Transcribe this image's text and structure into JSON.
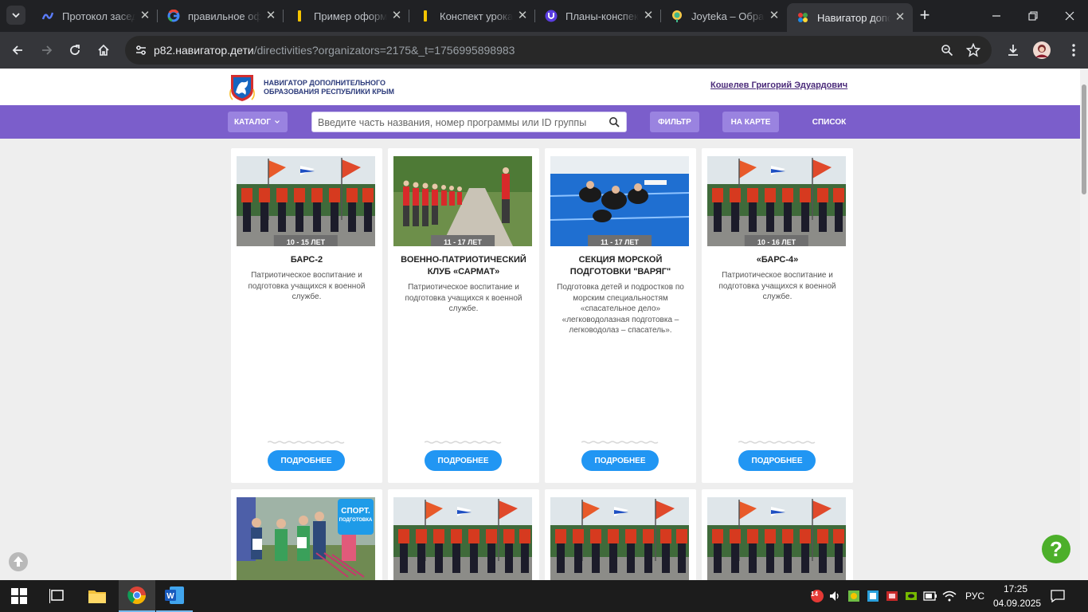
{
  "browser": {
    "tabs": [
      {
        "title": "Протокол засед",
        "icon": "doc-icon",
        "color": "#4a6cf7"
      },
      {
        "title": "правильное оф",
        "icon": "google-icon",
        "color": "#4285f4"
      },
      {
        "title": "Пример оформ",
        "icon": "yellow-bar-icon",
        "color": "#f5c400"
      },
      {
        "title": "Конспект урока",
        "icon": "yellow-bar-icon",
        "color": "#f5c400"
      },
      {
        "title": "Планы-конспек",
        "icon": "purple-u-icon",
        "color": "#6a3de8"
      },
      {
        "title": "Joyteka – Обра",
        "icon": "joyteka-icon",
        "color": "#3fb68b"
      },
      {
        "title": "Навигатор допо",
        "icon": "navigator-icon",
        "color": "#e53935"
      }
    ],
    "active_tab": 6,
    "url_host": "p82.навигатор.дети",
    "url_path": "/directivities?organizators=2175&_t=1756995898983"
  },
  "site": {
    "logo_line1": "НАВИГАТОР ДОПОЛНИТЕЛЬНОГО",
    "logo_line2": "ОБРАЗОВАНИЯ РЕСПУБЛИКИ КРЫМ",
    "user_name": "Кошелев Григорий Эдуардович",
    "nav": {
      "catalog_label": "КАТАЛОГ",
      "search_placeholder": "Введите часть названия, номер программы или ID группы",
      "filter_label": "ФИЛЬТР",
      "map_label": "НА КАРТЕ",
      "list_label": "СПИСОК"
    }
  },
  "cards": [
    {
      "age": "10 - 15 ЛЕТ",
      "title": "БАРС-2",
      "desc": "Патриотическое воспитание и подготовка учащихся к военной службе.",
      "more": "ПОДРОБНЕЕ",
      "photo": "parade"
    },
    {
      "age": "11 - 17 ЛЕТ",
      "title": "ВОЕННО-ПАТРИОТИЧЕСКИЙ КЛУБ «САРМАТ»",
      "desc": "Патриотическое воспитание и подготовка учащихся к военной службе.",
      "more": "ПОДРОБНЕЕ",
      "photo": "park"
    },
    {
      "age": "11 - 17 ЛЕТ",
      "title": "СЕКЦИЯ МОРСКОЙ ПОДГОТОВКИ \"ВАРЯГ\"",
      "desc": "Подготовка детей и подростков по морским специальностям «спасательное дело» «легководолазная подготовка – легководолаз – спасатель».",
      "more": "ПОДРОБНЕЕ",
      "photo": "pool"
    },
    {
      "age": "10 - 16 ЛЕТ",
      "title": "«БАРС-4»",
      "desc": "Патриотическое воспитание и подготовка учащихся к военной службе.",
      "more": "ПОДРОБНЕЕ",
      "photo": "parade"
    }
  ],
  "cards_row2": [
    {
      "photo": "group",
      "badge_top": "СПОРТ.",
      "badge_bottom": "ПОДГОТОВКА"
    },
    {
      "photo": "parade"
    },
    {
      "photo": "parade"
    },
    {
      "photo": "parade"
    }
  ],
  "taskbar": {
    "notification_count": "14",
    "language": "РУС",
    "time": "17:25",
    "date": "04.09.2025"
  }
}
